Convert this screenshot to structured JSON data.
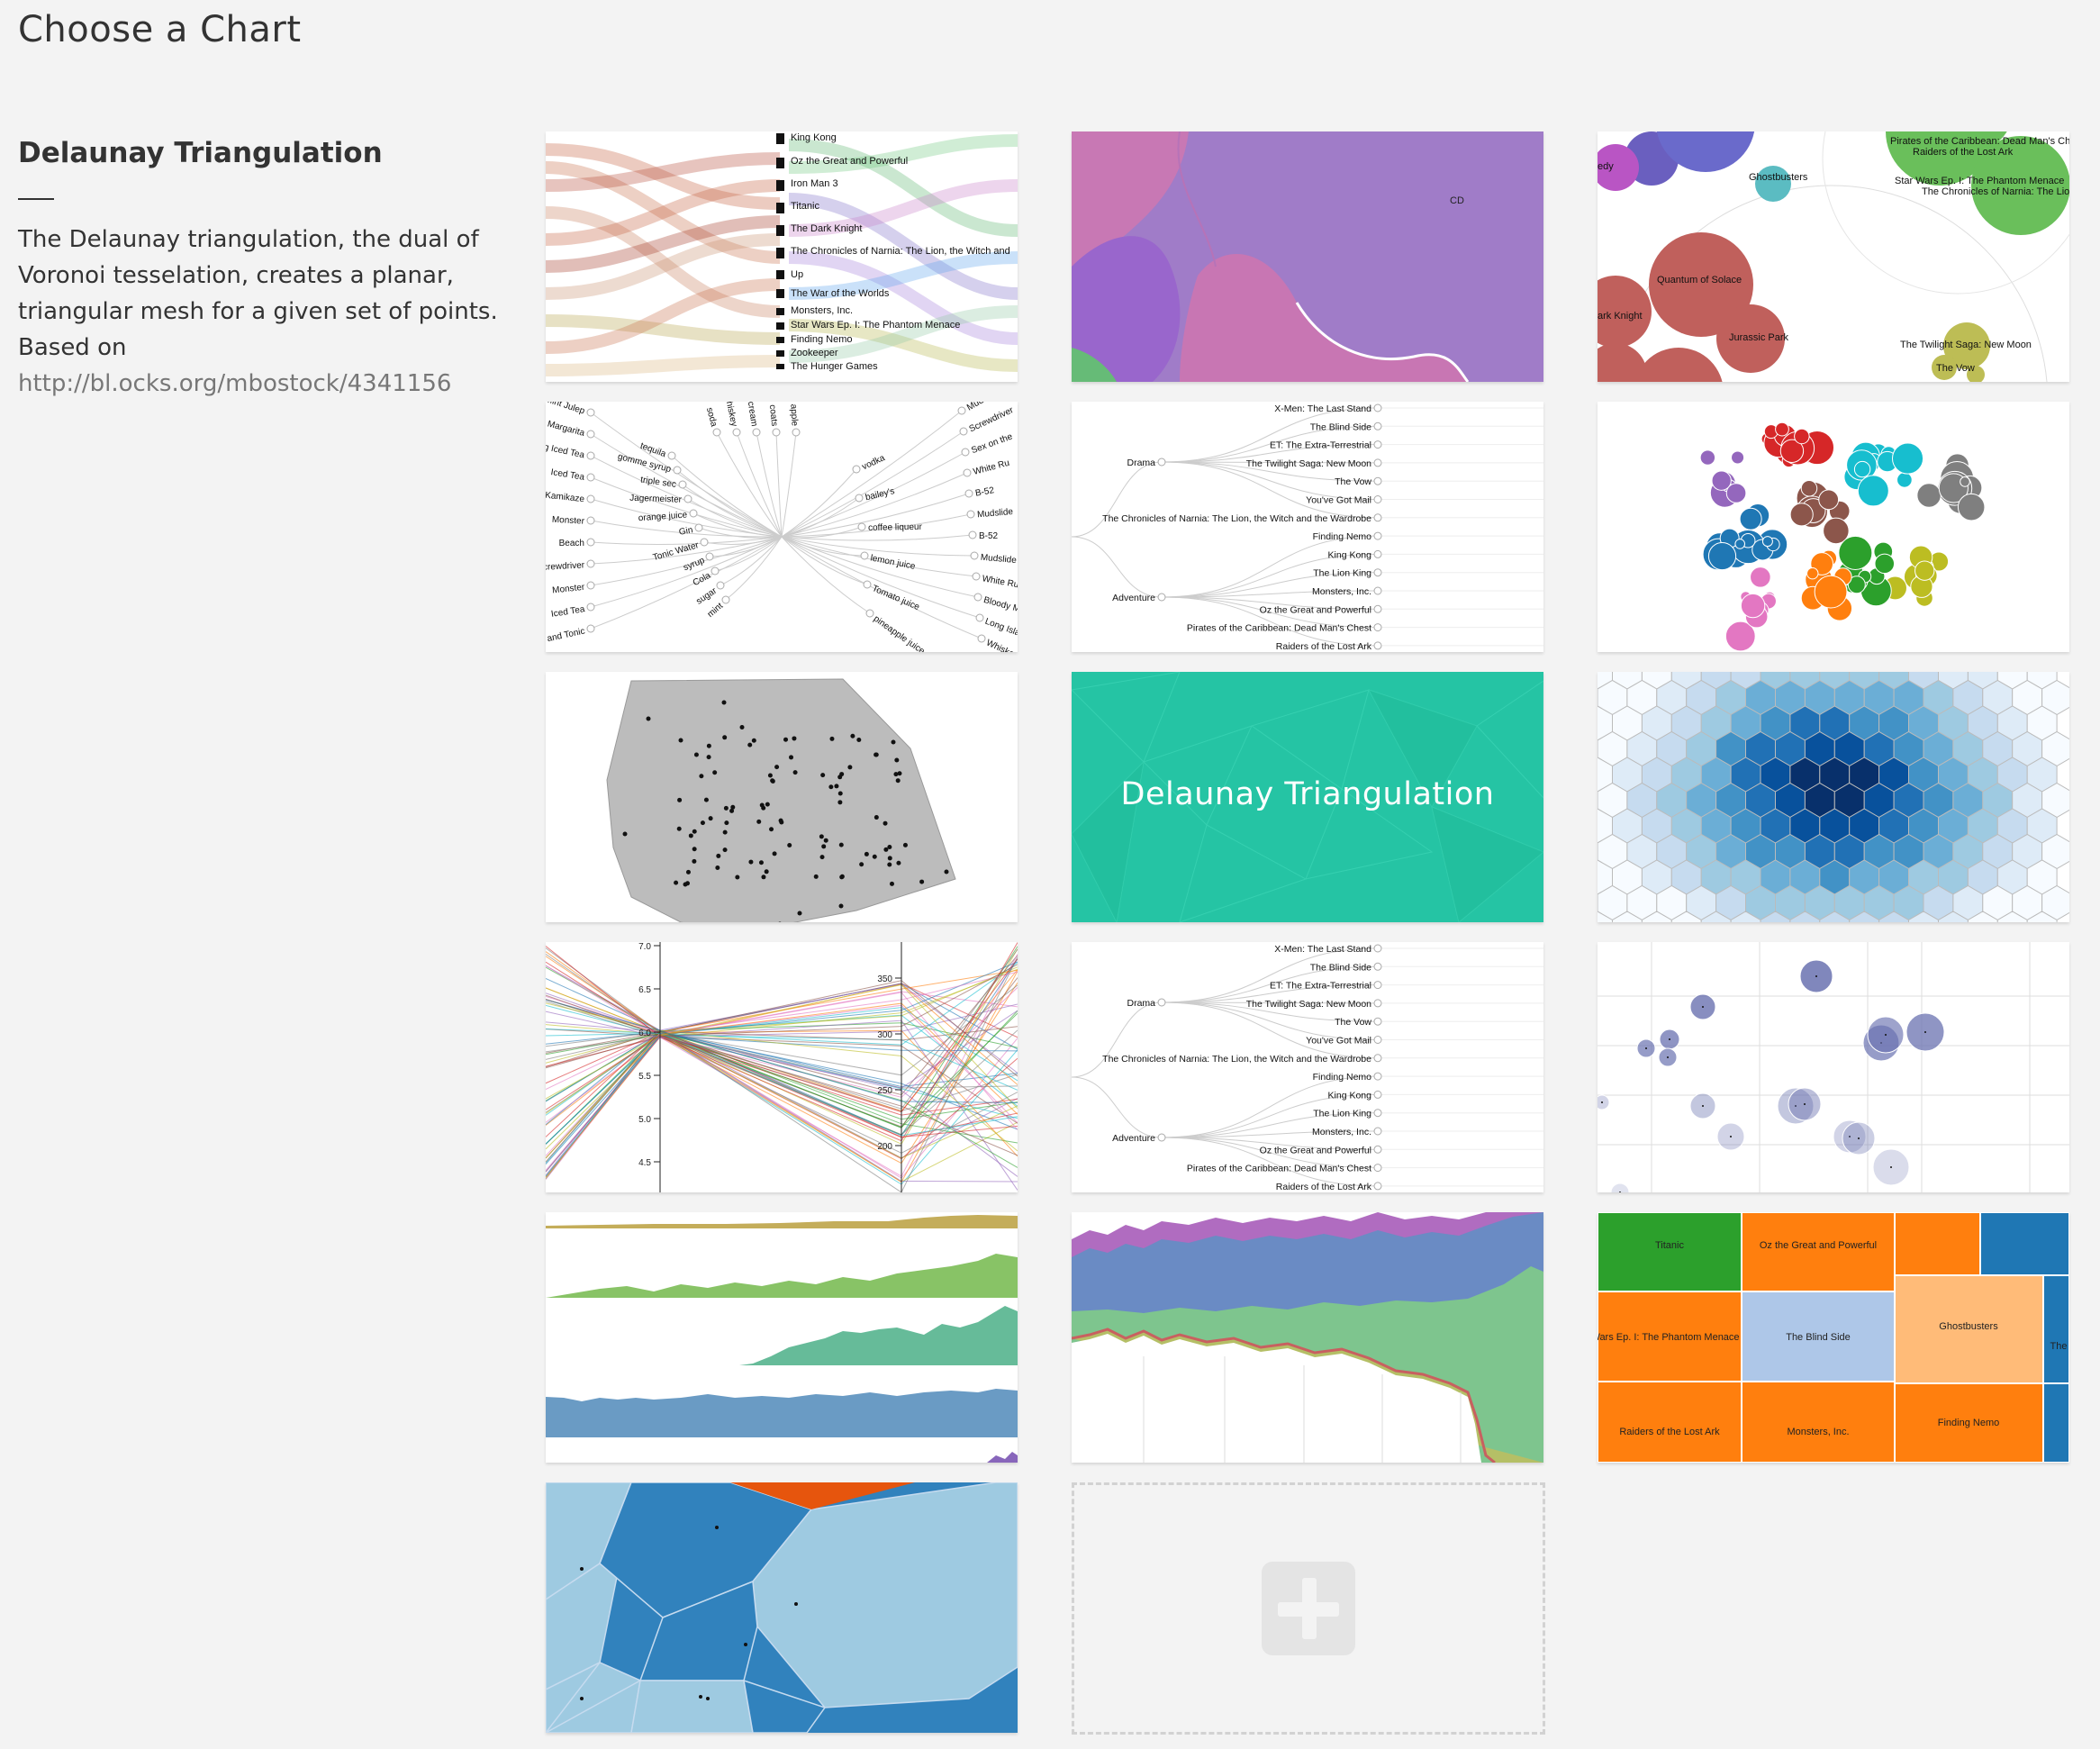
{
  "page": {
    "title": "Choose a Chart"
  },
  "selected_chart": {
    "title": "Delaunay Triangulation",
    "description": "The Delaunay triangulation, the dual of Voronoi tesselation, creates a planar, triangular mesh for a given set of points. Based on",
    "link": "http://bl.ocks.org/mbostock/4341156"
  },
  "accent_color": "#25c4a4",
  "tiles": {
    "t1": {
      "labels": [
        "King Kong",
        "Oz the Great and Powerful",
        "Iron Man 3",
        "Titanic",
        "The Dark Knight",
        "The Chronicles of Narnia: The Lion, the Witch and",
        "Up",
        "The War of the Worlds",
        "Monsters, Inc.",
        "Star Wars Ep. I: The Phantom Menace",
        "Finding Nemo",
        "Zookeeper",
        "The Hunger Games"
      ]
    },
    "t2": {
      "label": "CD"
    },
    "t3": {
      "labels": [
        "Pirates of the Caribbean: Dead Man's Chest",
        "Raiders of the Lost Ark",
        "Star Wars Ep. I: The Phantom Menace",
        "The Chronicles of Narnia: The Lion",
        "Quantum of Solace",
        "Jurassic Park",
        "The Twilight Saga: New Moon",
        "The Vow",
        "Ghostbusters",
        "ark Knight",
        "edy"
      ]
    },
    "t4": {
      "labels_left": [
        "Mint Julep",
        "Margarita",
        "Long Iced Tea",
        "Iced Tea",
        "Kamikaze",
        "Monster",
        "Beach",
        "Screwdriver",
        "Monster",
        "Iced Tea",
        "and Tonic"
      ],
      "labels_mid": [
        "tequila",
        "gomme syrup",
        "triple sec",
        "Jagermeister",
        "orange juice",
        "Gin",
        "Tonic Water",
        "syrup",
        "Cola",
        "sugar",
        "mint"
      ],
      "labels_top": [
        "soda",
        "whiskey",
        "cream",
        "coats",
        "apple"
      ],
      "labels_right_in": [
        "vodka",
        "bailey's",
        "coffee liqueur",
        "lemon juice",
        "Tomato juice",
        "pineapple juice"
      ],
      "labels_right": [
        "Mudslide",
        "Screwdriver",
        "Sex on the",
        "White Ru",
        "B-52",
        "Mudslide",
        "B-52",
        "Mudslide",
        "White Ru",
        "Bloody Mar",
        "Long Island",
        "Whiskey S"
      ]
    },
    "t5": {
      "group1": "Drama",
      "group2": "Adventure",
      "leaves": [
        "X-Men: The Last Stand",
        "The Blind Side",
        "ET: The Extra-Terrestrial",
        "The Twilight Saga: New Moon",
        "The Vow",
        "You've Got Mail",
        "The Chronicles of Narnia: The Lion, the Witch and the Wardrobe",
        "Finding Nemo",
        "King Kong",
        "The Lion King",
        "Monsters, Inc.",
        "Oz the Great and Powerful",
        "Pirates of the Caribbean: Dead Man's Chest",
        "Raiders of the Lost Ark"
      ]
    },
    "t8": {
      "label": "Delaunay Triangulation"
    },
    "t10": {
      "ticks_left": [
        "7.0",
        "6.5",
        "6.0",
        "5.5",
        "5.0",
        "4.5"
      ],
      "ticks_right": [
        "350",
        "300",
        "250",
        "200"
      ]
    },
    "t11": {
      "group1": "Drama",
      "group2": "Adventure",
      "leaves": [
        "X-Men: The Last Stand",
        "The Blind Side",
        "ET: The Extra-Terrestrial",
        "The Twilight Saga: New Moon",
        "The Vow",
        "You've Got Mail",
        "The Chronicles of Narnia: The Lion, the Witch and the Wardrobe",
        "Finding Nemo",
        "King Kong",
        "The Lion King",
        "Monsters, Inc.",
        "Oz the Great and Powerful",
        "Pirates of the Caribbean: Dead Man's Chest",
        "Raiders of the Lost Ark"
      ]
    },
    "t15": {
      "labels": [
        "Titanic",
        "Oz the Great and Powerful",
        "Wars Ep. I: The Phantom Menace",
        "The Blind Side",
        "Ghostbusters",
        "Raiders of the Lost Ark",
        "Monsters, Inc.",
        "Finding Nemo",
        "The"
      ]
    }
  }
}
